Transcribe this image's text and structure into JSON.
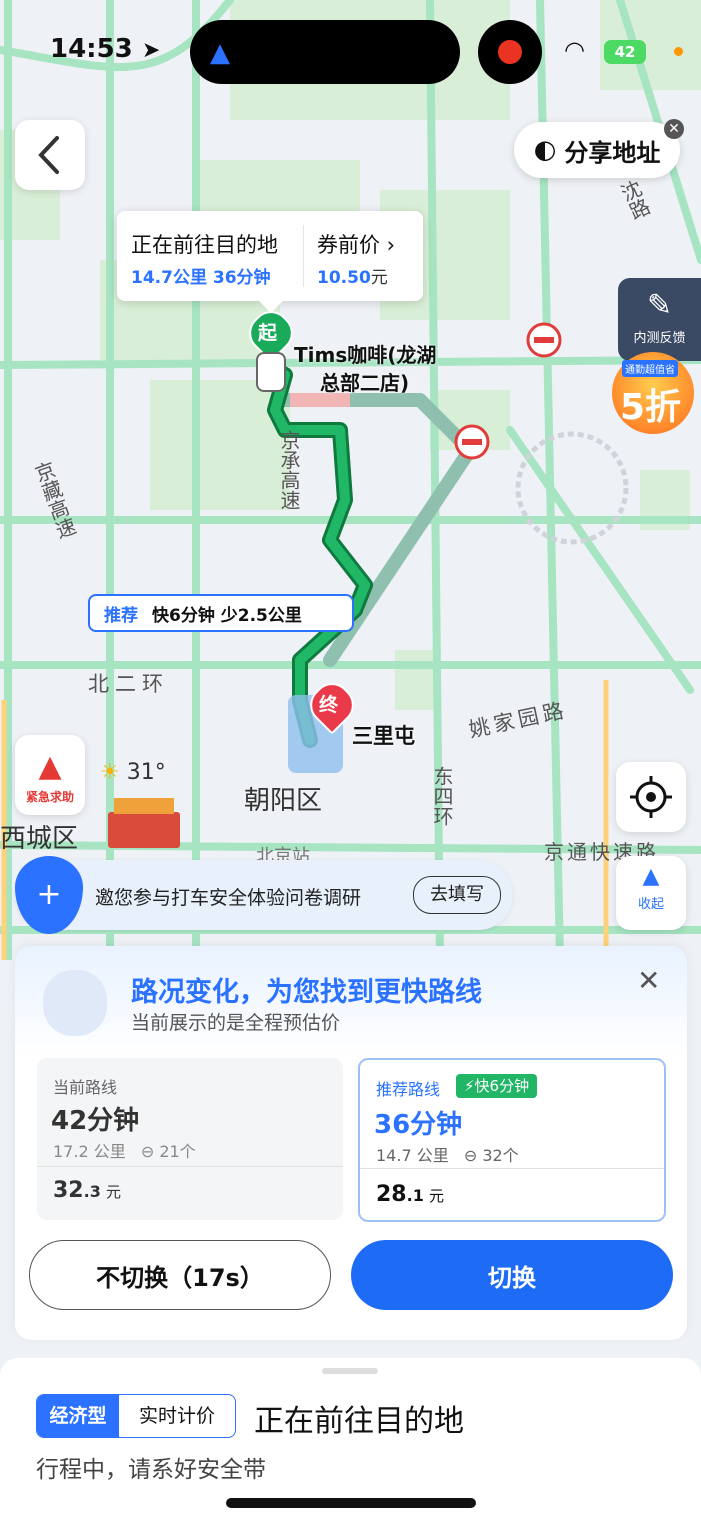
{
  "status": {
    "time": "14:53",
    "battery": "42"
  },
  "map": {
    "start_marker": "起",
    "end_marker": "终",
    "start_name_line1": "Tims咖啡(龙湖",
    "start_name_line2": "总部二店)",
    "end_name": "三里屯",
    "labels": {
      "jingzang": "京藏高速",
      "jingcheng": "京承高速",
      "ring2": "北二环",
      "yaojia": "姚家园路",
      "dongsi": "东四环",
      "chaoyang": "朝阳区",
      "xicheng": "西城区",
      "beijing_station": "北京站",
      "jingtong": "京通快速路",
      "road_top": "沈路",
      "temperature": "31°"
    }
  },
  "top": {
    "share_label": "分享地址",
    "info_title": "正在前往目的地",
    "info_distance_time": "14.7公里 36分钟",
    "price_title": "券前价",
    "price_value": "10.50",
    "price_unit": "元"
  },
  "feedback_label": "内测反馈",
  "promo": {
    "small": "通勤超值省",
    "big": "5折"
  },
  "recommend": {
    "tag": "推荐",
    "text": "快6分钟 少2.5公里"
  },
  "sos_label": "紧急求助",
  "collapse_label": "收起",
  "survey": {
    "text": "邀您参与打车安全体验问卷调研",
    "button": "去填写"
  },
  "route_card": {
    "title": "路况变化，为您找到更快路线",
    "subtitle": "当前展示的是全程预估价",
    "current": {
      "label": "当前路线",
      "time": "42分钟",
      "distance": "17.2 公里",
      "lights": "21个",
      "price_int": "32",
      "price_dec": ".3",
      "unit": "元"
    },
    "recommended": {
      "label": "推荐路线",
      "badge": "快6分钟",
      "time": "36分钟",
      "distance": "14.7 公里",
      "lights": "32个",
      "price_int": "28",
      "price_dec": ".1",
      "unit": "元"
    },
    "no_switch": "不切换（17s）",
    "switch": "切换"
  },
  "bottom_sheet": {
    "tag_type": "经济型",
    "tag_mode": "实时计价",
    "status": "正在前往目的地",
    "hint": "行程中，请系好安全带"
  }
}
